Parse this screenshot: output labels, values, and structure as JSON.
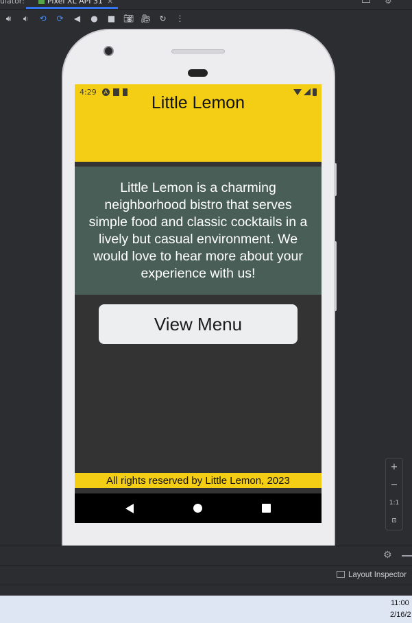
{
  "ide": {
    "tab_prefix": "ulator:",
    "tab_label": "Pixel XL API 31",
    "tab_close": "×",
    "toolbar_icons": [
      "volume-up-icon",
      "volume-down-icon",
      "rotate-left-icon",
      "rotate-right-icon",
      "back-triangle-icon",
      "home-circle-icon",
      "overview-square-icon",
      "screenshot-camera-icon",
      "screen-record-icon",
      "snapshot-restore-icon",
      "more-options-icon"
    ],
    "layout_inspector_label": "Layout Inspector",
    "zoom": {
      "plus": "+",
      "minus": "−",
      "one_to_one": "1:1"
    }
  },
  "device": {
    "status_time": "4:29",
    "app_title": "Little Lemon",
    "about_text": "Little Lemon is a charming neighborhood bistro that serves simple food and classic cocktails in a lively but casual environment. We would love to hear more about your experience with us!",
    "view_menu_label": "View Menu",
    "footer_text": "All rights reserved by Little Lemon, 2023",
    "colors": {
      "primary_yellow": "#F4CE14",
      "green": "#495E57",
      "background": "#333333"
    }
  },
  "taskbar": {
    "time": "11:00",
    "date": "2/16/2"
  }
}
